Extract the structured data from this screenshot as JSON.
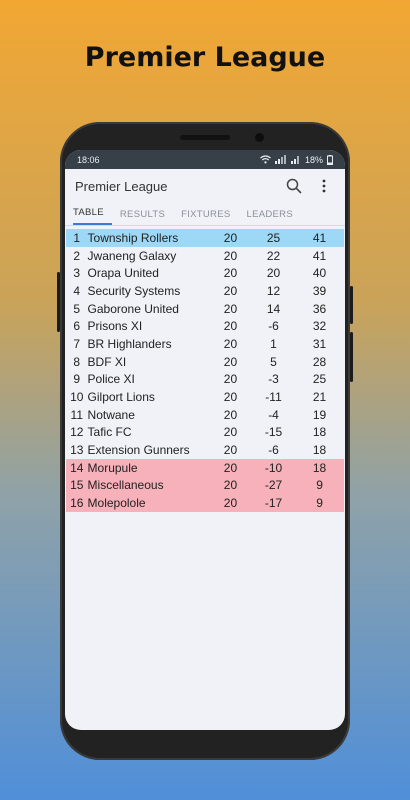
{
  "headline": "Premier League",
  "status_bar": {
    "time": "18:06",
    "battery": "18%"
  },
  "app_bar": {
    "title": "Premier League",
    "search_icon": "search-icon",
    "menu_icon": "more-vert-icon"
  },
  "tabs": [
    {
      "label": "TABLE",
      "active": true
    },
    {
      "label": "RESULTS",
      "active": false
    },
    {
      "label": "FIXTURES",
      "active": false
    },
    {
      "label": "LEADERS",
      "active": false
    }
  ],
  "colors": {
    "champion": "#9dd8f6",
    "relegation": "#f6b1ba",
    "accent": "#3a7bd5"
  },
  "standings": [
    {
      "pos": "1",
      "team": "Township Rollers",
      "played": "20",
      "gd": "25",
      "pts": "41",
      "zone": "champ"
    },
    {
      "pos": "2",
      "team": "Jwaneng Galaxy",
      "played": "20",
      "gd": "22",
      "pts": "41",
      "zone": ""
    },
    {
      "pos": "3",
      "team": "Orapa United",
      "played": "20",
      "gd": "20",
      "pts": "40",
      "zone": ""
    },
    {
      "pos": "4",
      "team": "Security Systems",
      "played": "20",
      "gd": "12",
      "pts": "39",
      "zone": ""
    },
    {
      "pos": "5",
      "team": "Gaborone United",
      "played": "20",
      "gd": "14",
      "pts": "36",
      "zone": ""
    },
    {
      "pos": "6",
      "team": "Prisons XI",
      "played": "20",
      "gd": "-6",
      "pts": "32",
      "zone": ""
    },
    {
      "pos": "7",
      "team": "BR Highlanders",
      "played": "20",
      "gd": "1",
      "pts": "31",
      "zone": ""
    },
    {
      "pos": "8",
      "team": "BDF XI",
      "played": "20",
      "gd": "5",
      "pts": "28",
      "zone": ""
    },
    {
      "pos": "9",
      "team": "Police XI",
      "played": "20",
      "gd": "-3",
      "pts": "25",
      "zone": ""
    },
    {
      "pos": "10",
      "team": "Gilport Lions",
      "played": "20",
      "gd": "-11",
      "pts": "21",
      "zone": ""
    },
    {
      "pos": "11",
      "team": "Notwane",
      "played": "20",
      "gd": "-4",
      "pts": "19",
      "zone": ""
    },
    {
      "pos": "12",
      "team": "Tafic FC",
      "played": "20",
      "gd": "-15",
      "pts": "18",
      "zone": ""
    },
    {
      "pos": "13",
      "team": "Extension Gunners",
      "played": "20",
      "gd": "-6",
      "pts": "18",
      "zone": ""
    },
    {
      "pos": "14",
      "team": "Morupule",
      "played": "20",
      "gd": "-10",
      "pts": "18",
      "zone": "releg"
    },
    {
      "pos": "15",
      "team": "Miscellaneous",
      "played": "20",
      "gd": "-27",
      "pts": "9",
      "zone": "releg"
    },
    {
      "pos": "16",
      "team": "Molepolole",
      "played": "20",
      "gd": "-17",
      "pts": "9",
      "zone": "releg"
    }
  ]
}
